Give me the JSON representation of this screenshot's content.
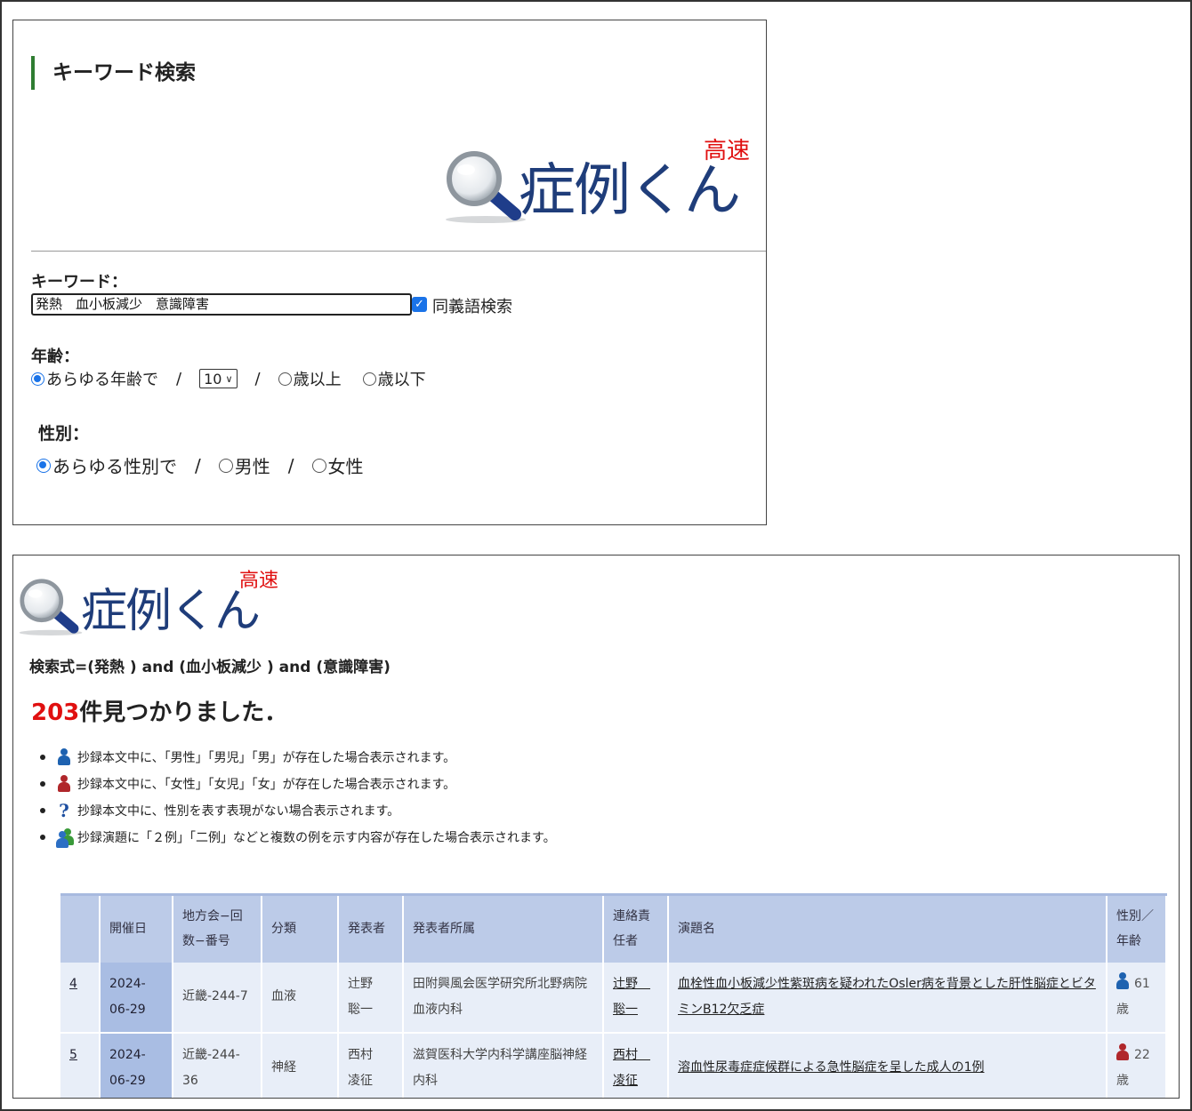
{
  "search_form": {
    "heading": "キーワード検索",
    "logo_text": "症例くん",
    "logo_badge": "高速",
    "keyword_label": "キーワード：",
    "keyword_value": "発熱　血小板減少　意識障害",
    "synonym_label": "同義語検索",
    "age_label": "年齢：",
    "age_any": "あらゆる年齢で",
    "age_select_value": "10",
    "age_above": "歳以上",
    "age_below": "歳以下",
    "gender_label": "性別：",
    "gender_any": "あらゆる性別で",
    "gender_male": "男性",
    "gender_female": "女性",
    "separator": "/"
  },
  "results": {
    "logo_text": "症例くん",
    "logo_badge": "高速",
    "query": "検索式=(発熱 ) and (血小板減少 ) and (意識障害)",
    "count_number": "203",
    "count_suffix": "件見つかりました．",
    "legend": [
      {
        "icon": "male-icon",
        "text": "抄録本文中に、「男性」「男児」「男」が存在した場合表示されます。"
      },
      {
        "icon": "female-icon",
        "text": "抄録本文中に、「女性」「女児」「女」が存在した場合表示されます。"
      },
      {
        "icon": "question-icon",
        "text": "抄録本文中に、性別を表す表現がない場合表示されます。"
      },
      {
        "icon": "multiple-people-icon",
        "text": "抄録演題に「２例」「二例」などと複数の例を示す内容が存在した場合表示されます。"
      }
    ],
    "table": {
      "headers": {
        "num": "",
        "date": "開催日",
        "region": "地方会−回数−番号",
        "category": "分類",
        "presenter": "発表者",
        "affiliation": "発表者所属",
        "contact": "連絡責任者",
        "title": "演題名",
        "sex_age": "性別／年齢"
      },
      "rows": [
        {
          "num": "4",
          "date": "2024-06-29",
          "region": "近畿-244-7",
          "category": "血液",
          "presenter": "辻野　聡一",
          "affiliation": "田附興風会医学研究所北野病院血液内科",
          "contact": "辻野　聡一",
          "title": "血栓性血小板減少性紫斑病を疑われたOsler病を背景とした肝性脳症とビタミンB12欠乏症",
          "sex_icon": "male-icon",
          "age": "61歳"
        },
        {
          "num": "5",
          "date": "2024-06-29",
          "region": "近畿-244-36",
          "category": "神経",
          "presenter": "西村　凌征",
          "affiliation": "滋賀医科大学内科学講座脳神経内科",
          "contact": "西村　凌征",
          "title": "溶血性尿毒症症候群による急性脳症を呈した成人の1例",
          "sex_icon": "female-icon",
          "age": "22歳"
        }
      ]
    }
  },
  "colors": {
    "logo_blue": "#1f3d7a",
    "badge_red": "#e01010",
    "heading_bar": "#2f7d32",
    "table_header": "#bccbe8",
    "table_cell": "#e8eef8",
    "date_cell": "#a9bde3"
  }
}
